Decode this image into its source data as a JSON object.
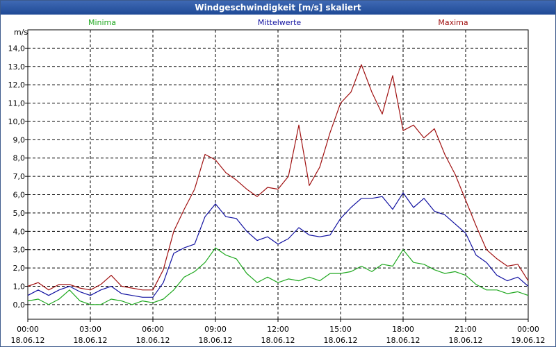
{
  "window": {
    "title": "Windgeschwindigkeit [m/s] skaliert"
  },
  "chart_data": {
    "type": "line",
    "title": "Windgeschwindigkeit [m/s] skaliert",
    "ylabel": "m/s",
    "xlabel": "",
    "ylim": [
      -0.8,
      15
    ],
    "xlim": [
      0,
      24
    ],
    "grid": true,
    "legend_placement": "top",
    "y_ticks": [
      "0,0",
      "1,0",
      "2,0",
      "3,0",
      "4,0",
      "5,0",
      "6,0",
      "7,0",
      "8,0",
      "9,0",
      "10,0",
      "11,0",
      "12,0",
      "13,0",
      "14,0"
    ],
    "x_ticks": [
      {
        "time": "00:00",
        "date": "18.06.12"
      },
      {
        "time": "03:00",
        "date": "18.06.12"
      },
      {
        "time": "06:00",
        "date": "18.06.12"
      },
      {
        "time": "09:00",
        "date": "18.06.12"
      },
      {
        "time": "12:00",
        "date": "18.06.12"
      },
      {
        "time": "15:00",
        "date": "18.06.12"
      },
      {
        "time": "18:00",
        "date": "18.06.12"
      },
      {
        "time": "21:00",
        "date": "18.06.12"
      },
      {
        "time": "00:00",
        "date": "19.06.12"
      }
    ],
    "x_hours": [
      0,
      0.5,
      1,
      1.5,
      2,
      2.5,
      3,
      3.5,
      4,
      4.5,
      5,
      5.5,
      6,
      6.5,
      7,
      7.5,
      8,
      8.5,
      9,
      9.5,
      10,
      10.5,
      11,
      11.5,
      12,
      12.5,
      13,
      13.5,
      14,
      14.5,
      15,
      15.5,
      16,
      16.5,
      17,
      17.5,
      18,
      18.5,
      19,
      19.5,
      20,
      20.5,
      21,
      21.5,
      22,
      22.5,
      23,
      23.5,
      24
    ],
    "series": [
      {
        "name": "Minima",
        "color": "#1fa81f",
        "values": [
          0.2,
          0.3,
          0.0,
          0.3,
          0.8,
          0.2,
          0.0,
          0.0,
          0.3,
          0.2,
          0.0,
          0.2,
          0.1,
          0.3,
          0.8,
          1.5,
          1.8,
          2.3,
          3.1,
          2.7,
          2.5,
          1.7,
          1.2,
          1.5,
          1.2,
          1.4,
          1.3,
          1.5,
          1.3,
          1.7,
          1.7,
          1.8,
          2.1,
          1.8,
          2.2,
          2.1,
          3.0,
          2.3,
          2.2,
          1.9,
          1.7,
          1.8,
          1.6,
          1.1,
          0.8,
          0.8,
          0.6,
          0.7,
          0.5
        ]
      },
      {
        "name": "Mittelwerte",
        "color": "#1010a0",
        "values": [
          0.5,
          0.8,
          0.5,
          0.8,
          1.0,
          0.7,
          0.5,
          0.8,
          1.0,
          0.6,
          0.5,
          0.4,
          0.4,
          1.2,
          2.8,
          3.1,
          3.3,
          4.8,
          5.5,
          4.8,
          4.7,
          4.0,
          3.5,
          3.7,
          3.3,
          3.6,
          4.2,
          3.8,
          3.7,
          3.8,
          4.7,
          5.3,
          5.8,
          5.8,
          5.9,
          5.2,
          6.1,
          5.3,
          5.8,
          5.1,
          4.9,
          4.4,
          3.9,
          2.7,
          2.3,
          1.6,
          1.3,
          1.5,
          1.0
        ]
      },
      {
        "name": "Maxima",
        "color": "#a01010",
        "values": [
          1.0,
          1.2,
          0.8,
          1.1,
          1.1,
          0.9,
          0.8,
          1.1,
          1.6,
          1.0,
          0.9,
          0.8,
          0.8,
          1.9,
          4.0,
          5.2,
          6.3,
          8.2,
          7.9,
          7.2,
          6.8,
          6.3,
          5.9,
          6.4,
          6.3,
          7.0,
          9.8,
          6.5,
          7.5,
          9.4,
          11.0,
          11.6,
          13.1,
          11.6,
          10.4,
          12.5,
          9.5,
          9.8,
          9.1,
          9.6,
          8.2,
          7.1,
          5.7,
          4.3,
          3.0,
          2.5,
          2.1,
          2.2,
          1.3
        ]
      }
    ]
  }
}
